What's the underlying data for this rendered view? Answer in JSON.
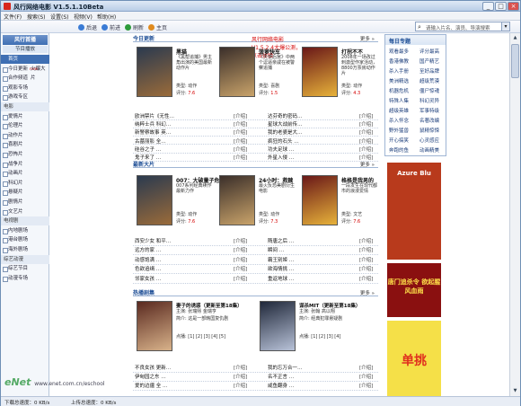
{
  "window": {
    "title": "风行网络电影 V1.5.1.10Beta"
  },
  "menu": [
    "文件(F)",
    "搜索(S)",
    "设置(S)",
    "视频(V)",
    "帮助(H)"
  ],
  "toolbar": {
    "back": "后退",
    "forward": "前进",
    "refresh": "刷新",
    "home": "主页"
  },
  "search": {
    "placeholder": "请输入片名、演员、导演搜索"
  },
  "sidebar": {
    "head": "风行首播",
    "sub": "节目播放",
    "rows": [
      {
        "label": "首页",
        "kind": "sel"
      },
      {
        "label": "今日更新",
        "kind": "it",
        "badge": "new",
        "extra": "火爆大片"
      },
      {
        "label": "合作频道",
        "kind": "it"
      },
      {
        "label": "观影专场",
        "kind": "it"
      },
      {
        "label": "游戏专区",
        "kind": "it"
      },
      {
        "label": "电影",
        "kind": "sec"
      },
      {
        "label": "爱情片",
        "kind": "it"
      },
      {
        "label": "伦理片",
        "kind": "it"
      },
      {
        "label": "动作片",
        "kind": "it"
      },
      {
        "label": "喜剧片",
        "kind": "it"
      },
      {
        "label": "恐怖片",
        "kind": "it"
      },
      {
        "label": "战争片",
        "kind": "it"
      },
      {
        "label": "动画片",
        "kind": "it"
      },
      {
        "label": "科幻片",
        "kind": "it"
      },
      {
        "label": "悬疑片",
        "kind": "it"
      },
      {
        "label": "剧情片",
        "kind": "it"
      },
      {
        "label": "文艺片",
        "kind": "it"
      },
      {
        "label": "电视剧",
        "kind": "sec"
      },
      {
        "label": "内地剧场",
        "kind": "it"
      },
      {
        "label": "港台剧场",
        "kind": "it"
      },
      {
        "label": "海外剧场",
        "kind": "it"
      },
      {
        "label": "综艺动漫",
        "kind": "sec"
      },
      {
        "label": "综艺节目",
        "kind": "it"
      },
      {
        "label": "动漫专场",
        "kind": "it"
      }
    ]
  },
  "today": {
    "title": "今日更新",
    "ad": "风行网络电影V1.5.2.4大爆公测，点击体验",
    "more": "更多 »",
    "movies": [
      {
        "title": "黑猫",
        "desc": "《黑帮追捕》男主角出演的美国最新动作片",
        "type": "类型: 动作",
        "score": "7.6"
      },
      {
        "title": "菠萝快车",
        "desc": "《天使后宫》中两个逗逼亲戚在被警察追捕",
        "type": "类型: 喜剧",
        "score": "1.5"
      },
      {
        "title": "打拐不不",
        "desc": "2008年一场改过刺激型作家活动，8800万票房动作片",
        "type": "类型: 动作",
        "score": "4.3"
      }
    ],
    "list": [
      [
        "欧洲禁片《无性…",
        "[介绍]",
        "达芬奇的密码…",
        "[介绍]"
      ],
      [
        "纳粹士兵 科幻…",
        "[介绍]",
        "星球大战前传…",
        "[介绍]"
      ],
      [
        "新警察故事 英…",
        "[介绍]",
        "我的老婆是大…",
        "[介绍]"
      ],
      [
        "古墓丽影 全…",
        "[介绍]",
        "疯狂的石头 …",
        "[介绍]"
      ],
      [
        "硅谷之子 …",
        "[介绍]",
        "功夫足球 …",
        "[介绍]"
      ],
      [
        "鬼子来了 …",
        "[介绍]",
        "外星入侵 …",
        "[介绍]"
      ]
    ]
  },
  "latest": {
    "title": "最新大片",
    "more": "更多 »",
    "movies": [
      {
        "title": "007：大破量子危机",
        "desc": "007系列经典续作最新力作",
        "type": "类型: 动作",
        "score": "7.6"
      },
      {
        "title": "24小时：救赎",
        "desc": "最火反恐美剧衍生电影",
        "type": "类型: 动作",
        "score": "7.3"
      },
      {
        "title": "格格是我男的",
        "desc": "一段发生在现代都市的浪漫爱情",
        "type": "类型: 文艺",
        "score": "7.6"
      }
    ],
    "list": [
      [
        "西安少女 和平…",
        "[介绍]",
        "隋唐之后 …",
        "[介绍]"
      ],
      [
        "远方的家 …",
        "[介绍]",
        "瞬间 …",
        "[介绍]"
      ],
      [
        "动感饱满 …",
        "[介绍]",
        "霸王别姬 …",
        "[介绍]"
      ],
      [
        "色欲追缉 …",
        "[介绍]",
        "欲海情挑 …",
        "[介绍]"
      ],
      [
        "邻家女孩 …",
        "[介绍]",
        "重返地球 …",
        "[介绍]"
      ]
    ]
  },
  "hot": {
    "title": "热播剧集",
    "more": "更多 »",
    "shows": [
      {
        "title": "妻子的诱惑（更新至第18集）",
        "cast": "主演: 张瑞熙 金瑞亨",
        "desc": "简介: 这是一部韩国复仇剧",
        "eps": "点播: [1] [2] [3] [4] [5]"
      },
      {
        "title": "谋杀MIT（更新至第18集）",
        "cast": "主演: 张翰 高以翔",
        "desc": "简介: 经典犯罪悬疑剧",
        "eps": "点播: [1] [2] [3] [4]"
      }
    ],
    "list": [
      [
        "不良女孩 更新…",
        "[介绍]",
        "我的忘万合一…",
        "[介绍]"
      ],
      [
        "伊甸园之东 …",
        "[介绍]",
        "名不正言 …",
        "[介绍]"
      ],
      [
        "爱的边疆 全 …",
        "[介绍]",
        "咸鱼翻身 …",
        "[介绍]"
      ]
    ]
  },
  "topics": {
    "title": "每日专题",
    "tags": [
      [
        "观看最多",
        "评分最高"
      ],
      [
        "香港佛教",
        "国产精艺"
      ],
      [
        "杀入手册",
        "至好品牌"
      ],
      [
        "美洲精选",
        "超级荒漠"
      ],
      [
        "机器危机",
        "僵尸惊魂"
      ],
      [
        "特殊人集",
        "科幻灵异"
      ],
      [
        "超级英雄",
        "军事特级"
      ],
      [
        "杀入怀念",
        "名著改编"
      ],
      [
        "野外猛兽",
        "鼠精惊悚"
      ],
      [
        "开心搞笑",
        "心灵感应"
      ],
      [
        "奔跑的鱼",
        "动画精美"
      ]
    ]
  },
  "ads": [
    {
      "text": "Azure Blu",
      "color": "#ffffff",
      "bg": "#b83a1c"
    },
    {
      "text": "唐门追杀令 欲起腥风血雨",
      "color": "#ffe14a",
      "bg": "#8a1010"
    },
    {
      "text": "单挑",
      "color": "#e0301e",
      "bg": "#f5e048"
    }
  ],
  "status": {
    "left": "下载总速度：0 KB/s",
    "mid": "上传总速度：0 KB/s"
  },
  "watermark": {
    "brand": "eNet",
    "url": "www.enet.com.cn/eschool"
  }
}
